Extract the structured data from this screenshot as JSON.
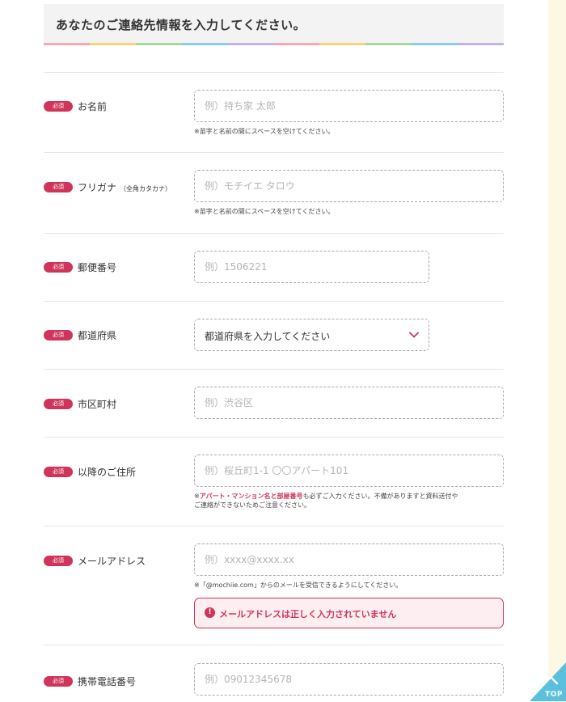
{
  "header": {
    "title": "あなたのご連絡先情報を入力してください。"
  },
  "colors": {
    "accent": "#d0345a",
    "rainbow": [
      "#f5a9b8",
      "#f9d27d",
      "#a8d8a0",
      "#8ecbe8",
      "#c5b3e0",
      "#f5a9b8",
      "#f9d27d",
      "#a8d8a0",
      "#8ecbe8",
      "#c5b3e0"
    ]
  },
  "required_label": "必須",
  "fields": {
    "name": {
      "label": "お名前",
      "placeholder": "例）持ち家 太郎",
      "note": "※苗字と名前の間にスペースを空けてください。"
    },
    "furigana": {
      "label": "フリガナ",
      "sublabel": "（全角カタカナ）",
      "placeholder": "例）モチイエ タロウ",
      "note": "※苗字と名前の間にスペースを空けてください。"
    },
    "postal": {
      "label": "郵便番号",
      "placeholder": "例）1506221"
    },
    "prefecture": {
      "label": "都道府県",
      "selected": "都道府県を入力してください"
    },
    "city": {
      "label": "市区町村",
      "placeholder": "例）渋谷区"
    },
    "address": {
      "label": "以降のご住所",
      "placeholder": "例）桜丘町1-1 〇〇アパート101",
      "note_prefix": "※",
      "note_emphasis": "アパート・マンション名と部屋番号",
      "note_suffix": "も必ずご入力ください。不備がありますと資料送付や",
      "note_line2": "ご連絡ができないためご注意ください。"
    },
    "email": {
      "label": "メールアドレス",
      "placeholder": "例）xxxx@xxxx.xx",
      "note": "※「@mochiie.com」からのメールを受信できるようにしてください。",
      "error": "メールアドレスは正しく入力されていません"
    },
    "mobile": {
      "label": "携帯電話番号",
      "placeholder": "例）09012345678"
    }
  },
  "top_button": {
    "label": "TOP"
  }
}
